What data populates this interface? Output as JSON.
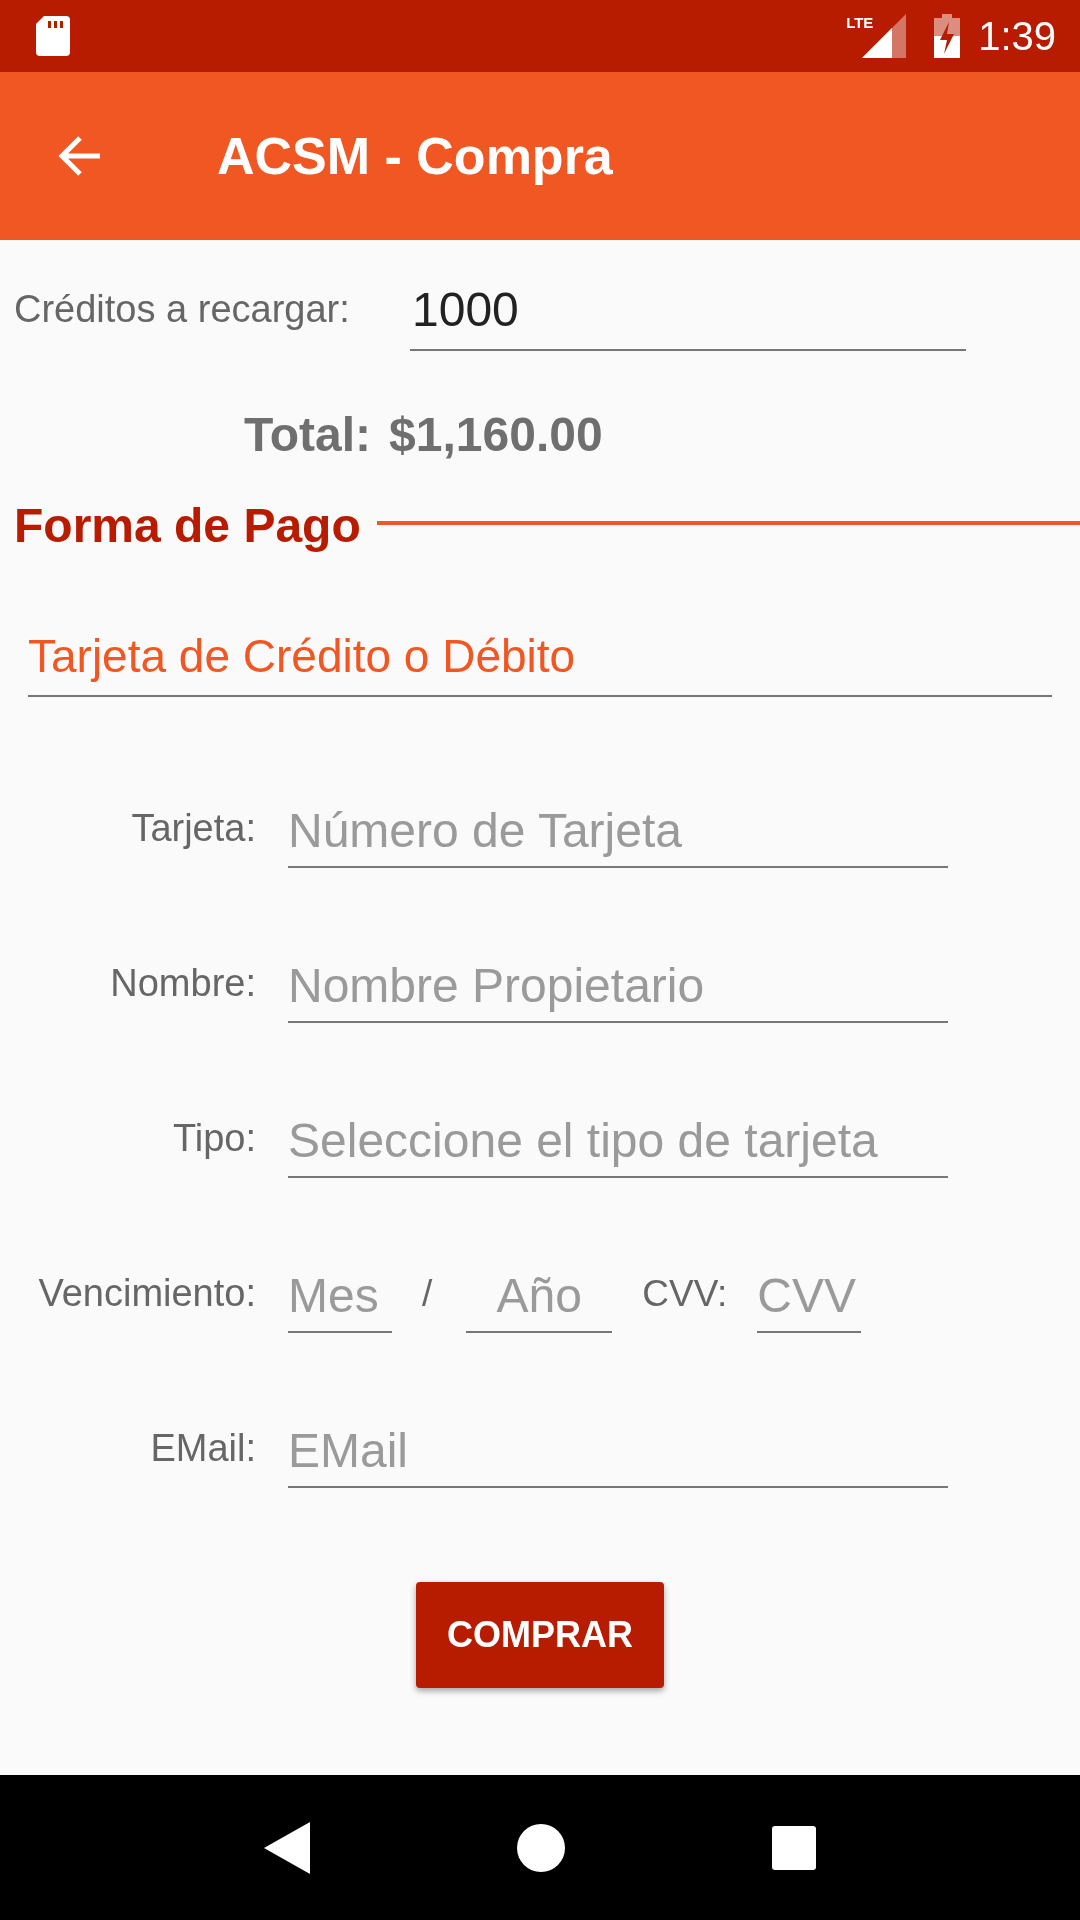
{
  "status_bar": {
    "time": "1:39",
    "network": "LTE"
  },
  "app_bar": {
    "title": "ACSM - Compra"
  },
  "credits": {
    "label": "Créditos a recargar:",
    "value": "1000"
  },
  "total": {
    "label": "Total:",
    "value": "$1,160.00"
  },
  "payment_section": {
    "title": "Forma de Pago",
    "method": "Tarjeta de Crédito o Débito"
  },
  "form_rows": [
    {
      "label": "Tarjeta:",
      "parts": [
        {
          "kind": "field",
          "placeholder": "Número de Tarjeta"
        }
      ]
    },
    {
      "label": "Nombre:",
      "parts": [
        {
          "kind": "field",
          "placeholder": "Nombre Propietario"
        }
      ]
    },
    {
      "label": "Tipo:",
      "parts": [
        {
          "kind": "field",
          "placeholder": "Seleccione el tipo de tarjeta"
        }
      ]
    },
    {
      "label": "Vencimiento:",
      "parts": [
        {
          "kind": "field",
          "placeholder": "Mes"
        },
        {
          "kind": "separator",
          "text": "/"
        },
        {
          "kind": "field",
          "placeholder": "Año"
        },
        {
          "kind": "label",
          "text": "CVV:"
        },
        {
          "kind": "field",
          "placeholder": "CVV"
        }
      ]
    },
    {
      "label": "EMail:",
      "parts": [
        {
          "kind": "field",
          "placeholder": "EMail"
        }
      ]
    }
  ],
  "buy_button": "COMPRAR"
}
